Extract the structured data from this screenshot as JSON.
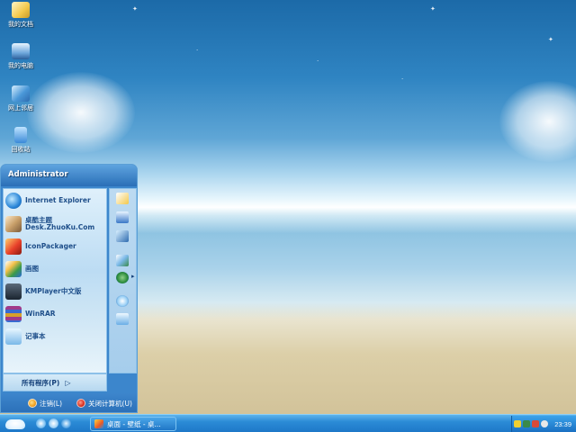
{
  "desktop": {
    "icons": [
      {
        "label": "我的文档",
        "icon": "folder-documents-icon"
      },
      {
        "label": "我的电脑",
        "icon": "computer-icon"
      },
      {
        "label": "网上邻居",
        "icon": "network-places-icon"
      },
      {
        "label": "回收站",
        "icon": "recycle-bin-icon"
      }
    ]
  },
  "start_menu": {
    "user": "Administrator",
    "programs": [
      {
        "label": "Internet Explorer",
        "icon": "internet-explorer-icon"
      },
      {
        "label": "桌酷主题",
        "sublabel": "Desk.ZhuoKu.Com",
        "icon": "theme-icon"
      },
      {
        "label": "IconPackager",
        "icon": "iconpackager-icon"
      },
      {
        "label": "画图",
        "icon": "paint-icon"
      },
      {
        "label": "KMPlayer中文版",
        "icon": "kmplayer-icon"
      },
      {
        "label": "WinRAR",
        "icon": "winrar-icon"
      },
      {
        "label": "记事本",
        "icon": "notepad-icon"
      }
    ],
    "places_icons": [
      "documents-folder-icon",
      "computer-icon",
      "network-icon",
      "control-panel-icon",
      "internet-icon",
      "search-icon",
      "run-icon"
    ],
    "all_programs": "所有程序(P)",
    "logoff": "注销(L)",
    "shutdown": "关闭计算机(U)"
  },
  "taskbar": {
    "task_item": "桌面 - 壁纸 - 桌...",
    "clock": "23:39"
  },
  "colors": {
    "taskbar": "#1e78c8",
    "menu_header": "#2a6fb7",
    "program_text": "#1f4f8a",
    "logoff": "#f0a020",
    "shutdown": "#d83020"
  }
}
